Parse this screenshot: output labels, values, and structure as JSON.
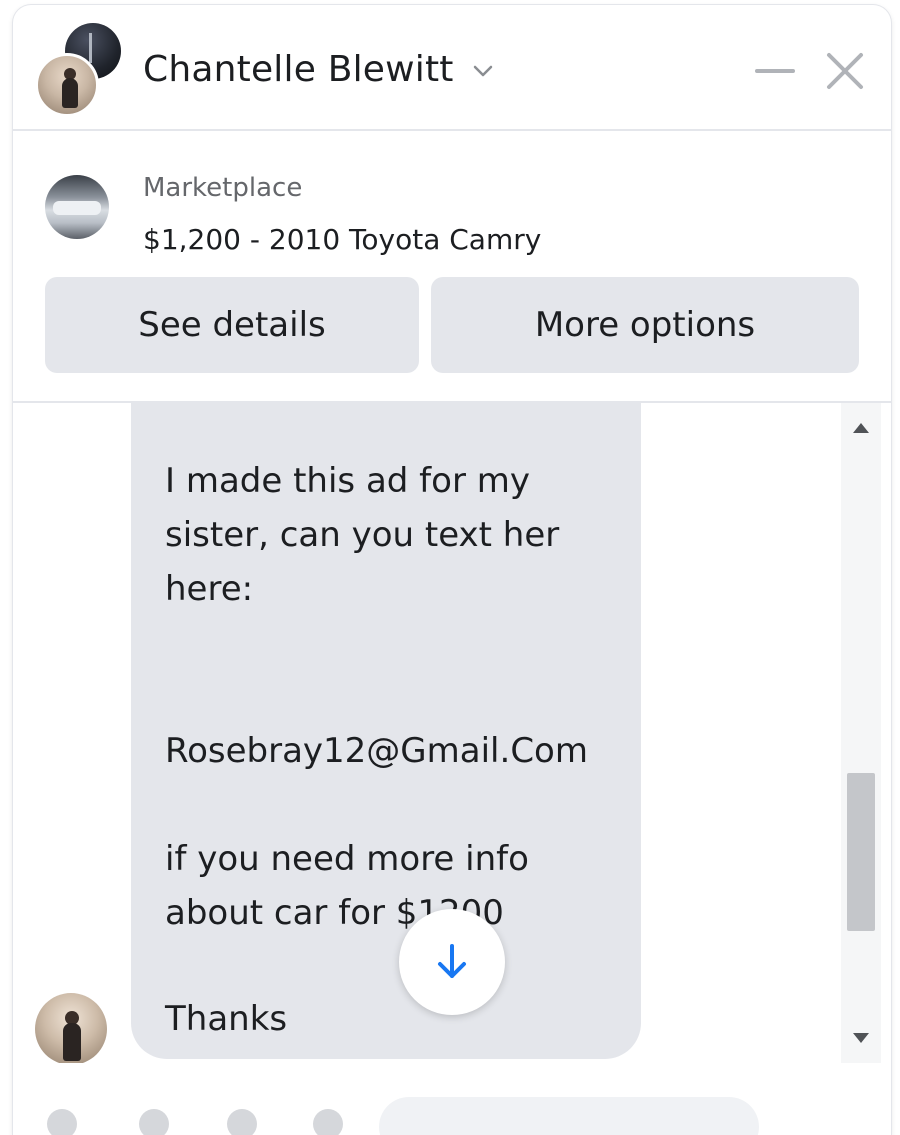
{
  "header": {
    "contact_name": "Chantelle Blewitt"
  },
  "listing": {
    "source": "Marketplace",
    "title": "$1,200 - 2010 Toyota Camry",
    "see_details_label": "See details",
    "more_options_label": "More options"
  },
  "message": {
    "lines": [
      "I made this ad for my",
      "sister, can you text her",
      "here:",
      "Rosebray12@Gmail.Com",
      "if you need more info",
      "about car for $1200",
      "Thanks"
    ]
  },
  "icons": {
    "chevron": "chevron-down-icon",
    "minimize": "minimize-icon",
    "close": "close-icon",
    "scroll_down": "arrow-down-icon"
  },
  "colors": {
    "accent": "#1877f2",
    "bubble": "#e4e6eb",
    "button": "#e4e6eb",
    "secondary_text": "#65676b"
  }
}
